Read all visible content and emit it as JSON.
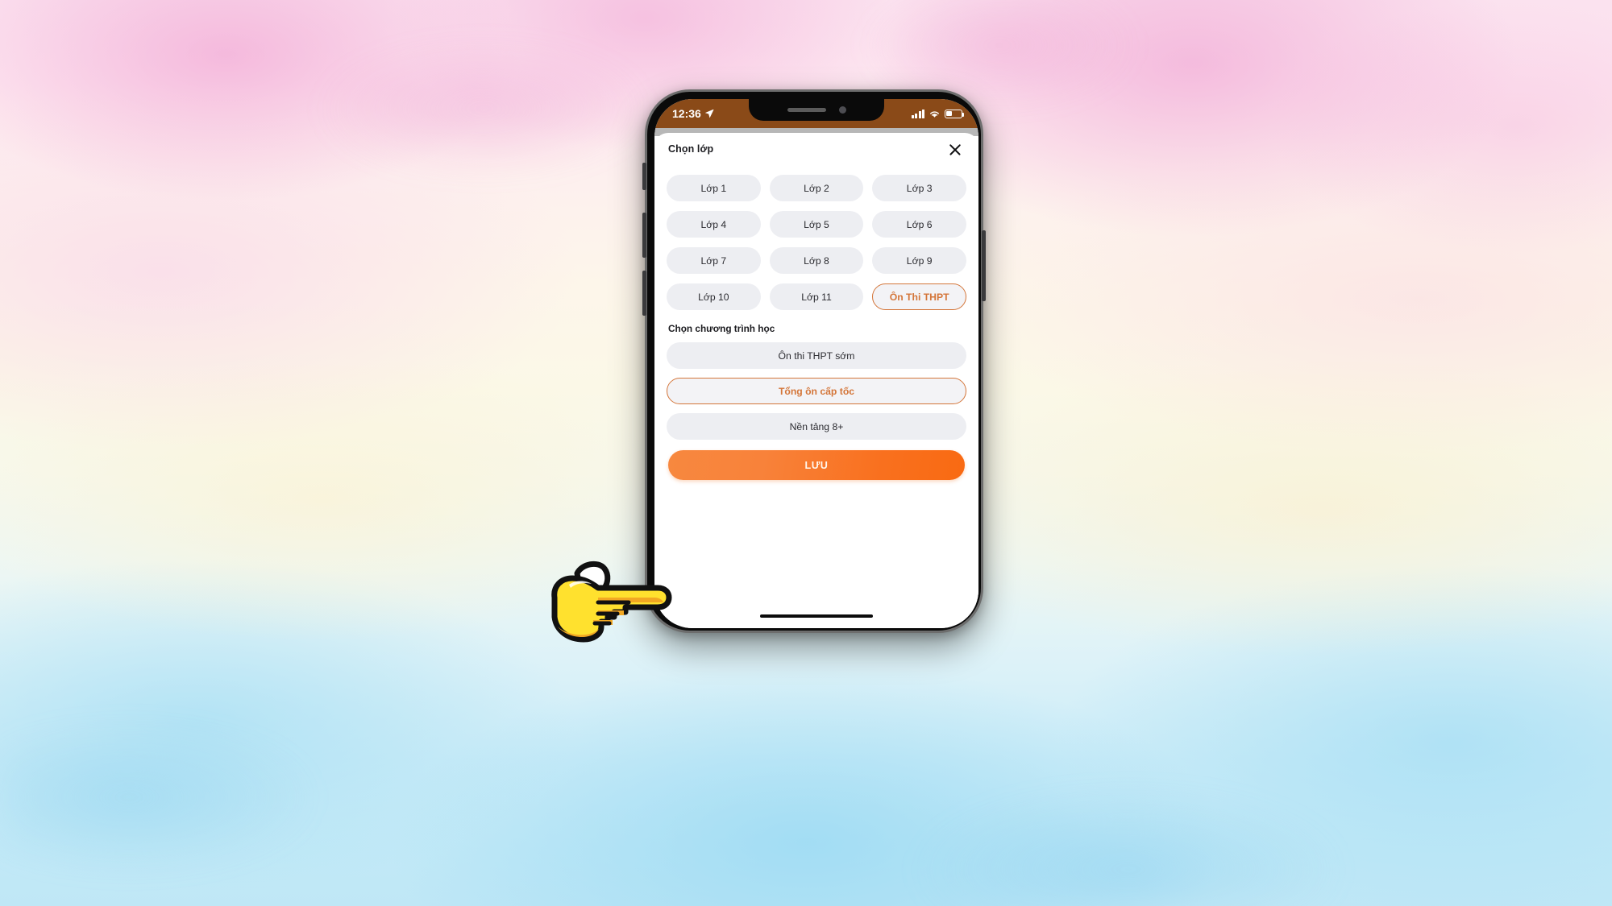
{
  "background": {
    "description": "pastel watercolor gradient",
    "top_color": "#fbe2ef",
    "mid_color": "#fbf8e7",
    "bottom_color": "#bfe7f6"
  },
  "device": {
    "frame_color": "#0a0a0a",
    "bezel_color": "#6d6d6d",
    "buttons": [
      {
        "name": "silent-switch"
      },
      {
        "name": "volume-up-button"
      },
      {
        "name": "volume-down-button"
      },
      {
        "name": "power-button"
      }
    ],
    "home_indicator": true
  },
  "status_bar": {
    "time": "12:36",
    "location_icon": "location-arrow-icon",
    "signal_icon": "cellular-signal-icon",
    "wifi_icon": "wifi-icon",
    "battery_icon": "battery-icon",
    "battery_level_percent": 40,
    "background_color": "#8a4a18",
    "text_color": "#ffffff"
  },
  "notch": {
    "speaker": "speaker-grille",
    "camera": "front-camera"
  },
  "sheet": {
    "title": "Chọn lớp",
    "close_icon": "close-icon",
    "accent_color": "#d4763a",
    "pill_background": "#edeef2",
    "grades": [
      {
        "label": "Lớp 1",
        "selected": false
      },
      {
        "label": "Lớp 2",
        "selected": false
      },
      {
        "label": "Lớp 3",
        "selected": false
      },
      {
        "label": "Lớp 4",
        "selected": false
      },
      {
        "label": "Lớp 5",
        "selected": false
      },
      {
        "label": "Lớp 6",
        "selected": false
      },
      {
        "label": "Lớp 7",
        "selected": false
      },
      {
        "label": "Lớp 8",
        "selected": false
      },
      {
        "label": "Lớp 9",
        "selected": false
      },
      {
        "label": "Lớp 10",
        "selected": false
      },
      {
        "label": "Lớp 11",
        "selected": false
      },
      {
        "label": "Ôn Thi THPT",
        "selected": true
      }
    ],
    "program_label": "Chọn chương trình học",
    "programs": [
      {
        "label": "Ôn thi THPT sớm",
        "selected": false
      },
      {
        "label": "Tổng ôn cấp tốc",
        "selected": true
      },
      {
        "label": "Nền tảng 8+",
        "selected": false
      }
    ],
    "save_button": {
      "label": "LƯU",
      "gradient_from": "#f7883f",
      "gradient_to": "#f96a12",
      "text_color": "#fff7ee"
    }
  },
  "overlay": {
    "cursor_icon": "pointing-hand-right-icon",
    "hand_fill": "#ffe12e",
    "hand_shadow": "#f2a823"
  }
}
